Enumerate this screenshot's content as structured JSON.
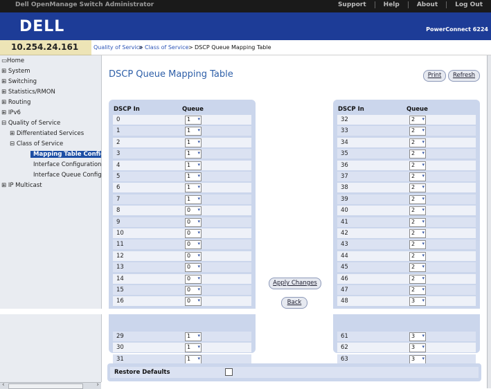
{
  "topbar": {
    "title": "Dell OpenManage Switch Administrator",
    "links": [
      "Support",
      "Help",
      "About",
      "Log Out"
    ]
  },
  "header": {
    "logo": "DELL",
    "product": "PowerConnect 6224"
  },
  "ip_address": "10.254.24.161",
  "breadcrumb": {
    "items": [
      "Quality of Service",
      "Class of Service",
      "DSCP Queue Mapping Table"
    ],
    "separator": ">"
  },
  "sidenav": {
    "items": [
      {
        "label": "Home",
        "prefix": "▭"
      },
      {
        "label": "System",
        "prefix": "⊞"
      },
      {
        "label": "Switching",
        "prefix": "⊞"
      },
      {
        "label": "Statistics/RMON",
        "prefix": "⊞"
      },
      {
        "label": "Routing",
        "prefix": "⊞"
      },
      {
        "label": "IPv6",
        "prefix": "⊞"
      },
      {
        "label": "Quality of Service",
        "prefix": "⊟"
      },
      {
        "label": "Differentiated Services",
        "prefix": "⊞"
      },
      {
        "label": "Class of Service",
        "prefix": "⊟"
      },
      {
        "label": "Mapping Table Configuration",
        "prefix": ""
      },
      {
        "label": "Interface Configuration",
        "prefix": ""
      },
      {
        "label": "Interface Queue Configuration",
        "prefix": ""
      },
      {
        "label": "IP Multicast",
        "prefix": "⊞"
      }
    ]
  },
  "main": {
    "title": "DSCP Queue Mapping Table",
    "print_label": "Print",
    "refresh_label": "Refresh",
    "apply_label": "Apply Changes",
    "back_label": "Back",
    "col_dscp": "DSCP In",
    "col_queue": "Queue",
    "left_rows": [
      {
        "dscp": "0",
        "queue": "1"
      },
      {
        "dscp": "1",
        "queue": "1"
      },
      {
        "dscp": "2",
        "queue": "1"
      },
      {
        "dscp": "3",
        "queue": "1"
      },
      {
        "dscp": "4",
        "queue": "1"
      },
      {
        "dscp": "5",
        "queue": "1"
      },
      {
        "dscp": "6",
        "queue": "1"
      },
      {
        "dscp": "7",
        "queue": "1"
      },
      {
        "dscp": "8",
        "queue": "0"
      },
      {
        "dscp": "9",
        "queue": "0"
      },
      {
        "dscp": "10",
        "queue": "0"
      },
      {
        "dscp": "11",
        "queue": "0"
      },
      {
        "dscp": "12",
        "queue": "0"
      },
      {
        "dscp": "13",
        "queue": "0"
      },
      {
        "dscp": "14",
        "queue": "0"
      },
      {
        "dscp": "15",
        "queue": "0"
      },
      {
        "dscp": "16",
        "queue": "0"
      },
      {
        "dscp": "29",
        "queue": "1"
      },
      {
        "dscp": "30",
        "queue": "1"
      },
      {
        "dscp": "31",
        "queue": "1"
      }
    ],
    "right_rows": [
      {
        "dscp": "32",
        "queue": "2"
      },
      {
        "dscp": "33",
        "queue": "2"
      },
      {
        "dscp": "34",
        "queue": "2"
      },
      {
        "dscp": "35",
        "queue": "2"
      },
      {
        "dscp": "36",
        "queue": "2"
      },
      {
        "dscp": "37",
        "queue": "2"
      },
      {
        "dscp": "38",
        "queue": "2"
      },
      {
        "dscp": "39",
        "queue": "2"
      },
      {
        "dscp": "40",
        "queue": "2"
      },
      {
        "dscp": "41",
        "queue": "2"
      },
      {
        "dscp": "42",
        "queue": "2"
      },
      {
        "dscp": "43",
        "queue": "2"
      },
      {
        "dscp": "44",
        "queue": "2"
      },
      {
        "dscp": "45",
        "queue": "2"
      },
      {
        "dscp": "46",
        "queue": "2"
      },
      {
        "dscp": "47",
        "queue": "2"
      },
      {
        "dscp": "48",
        "queue": "3"
      },
      {
        "dscp": "61",
        "queue": "3"
      },
      {
        "dscp": "62",
        "queue": "3"
      },
      {
        "dscp": "63",
        "queue": "3"
      }
    ],
    "restore_label": "Restore Defaults",
    "restore_checked": false
  },
  "colors": {
    "header_blue": "#1d3c97",
    "title_blue": "#2e5fa8",
    "panel": "#cbd6ec",
    "nav_active": "#1c4ea4"
  }
}
